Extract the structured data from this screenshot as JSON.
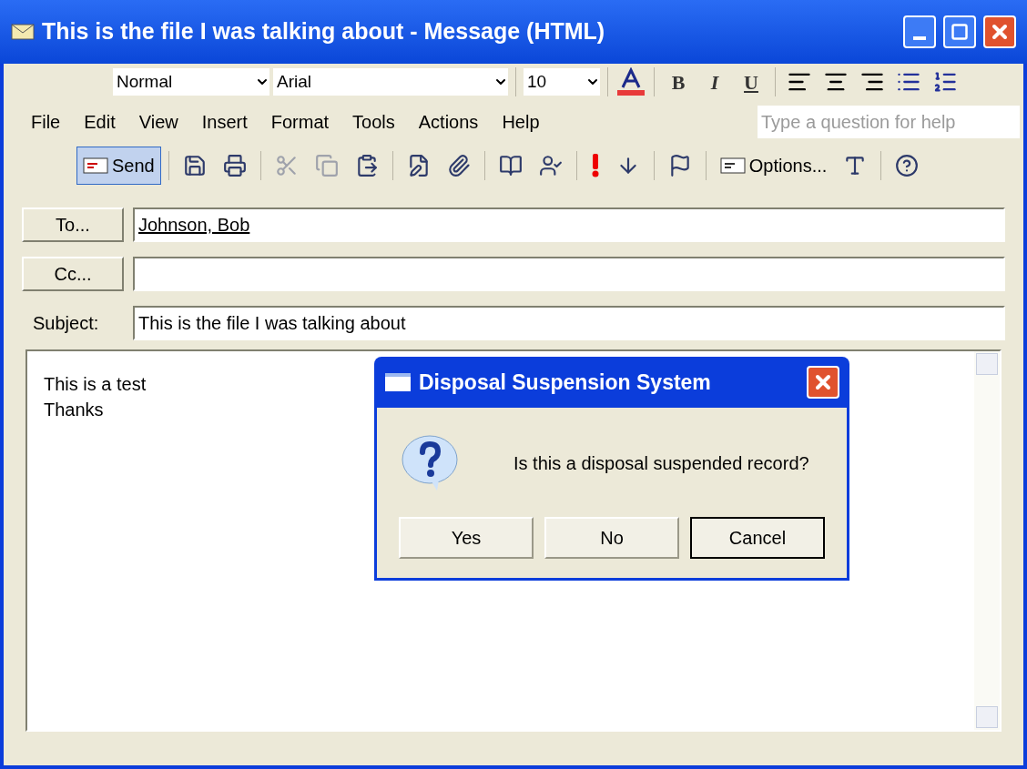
{
  "window": {
    "title": "This is the file I was talking about - Message (HTML)"
  },
  "format_toolbar": {
    "style": "Normal",
    "font": "Arial",
    "size": "10",
    "bold": "B",
    "italic": "I",
    "underline": "U"
  },
  "menu": [
    "File",
    "Edit",
    "View",
    "Insert",
    "Format",
    "Tools",
    "Actions",
    "Help"
  ],
  "help_search": {
    "placeholder": "Type a question for help"
  },
  "standard_toolbar": [
    {
      "kind": "text",
      "label": "Send",
      "pressed": true,
      "disabled": false
    },
    {
      "kind": "icon",
      "pressed": false,
      "disabled": false
    },
    {
      "kind": "icon",
      "pressed": false,
      "disabled": false
    },
    {
      "kind": "icon",
      "pressed": false,
      "disabled": true
    },
    {
      "kind": "icon",
      "pressed": false,
      "disabled": true
    },
    {
      "kind": "icon",
      "pressed": false,
      "disabled": false
    },
    {
      "kind": "icon",
      "pressed": false,
      "disabled": false
    },
    {
      "kind": "icon",
      "pressed": false,
      "disabled": false
    },
    {
      "kind": "icon",
      "pressed": false,
      "disabled": false
    },
    {
      "kind": "icon",
      "pressed": false,
      "disabled": false
    },
    {
      "kind": "icon",
      "pressed": false,
      "disabled": false
    },
    {
      "kind": "icon",
      "pressed": false,
      "disabled": false
    },
    {
      "kind": "icon",
      "pressed": false,
      "disabled": false
    },
    {
      "kind": "text",
      "label": "Options...",
      "pressed": false,
      "disabled": false
    },
    {
      "kind": "icon",
      "pressed": false,
      "disabled": false
    },
    {
      "kind": "icon",
      "pressed": false,
      "disabled": false
    }
  ],
  "header": {
    "to_button": "To...",
    "to": "Johnson, Bob",
    "cc_button": "Cc...",
    "subject_label": "Subject:",
    "subject": "This is the file I was talking about"
  },
  "body": [
    "This is a test",
    "Thanks"
  ],
  "dialog": {
    "title": "Disposal Suspension System",
    "message": "Is this a disposal suspended record?",
    "buttons": [
      {
        "label": "Yes",
        "default": false
      },
      {
        "label": "No",
        "default": false
      },
      {
        "label": "Cancel",
        "default": true
      }
    ]
  }
}
